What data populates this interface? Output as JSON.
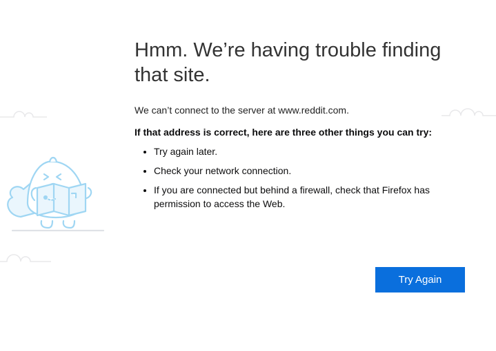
{
  "title": "Hmm. We’re having trouble finding that site.",
  "description": "We can’t connect to the server at www.reddit.com.",
  "instructions_heading": "If that address is correct, here are three other things you can try:",
  "suggestions": {
    "item1": "Try again later.",
    "item2": "Check your network connection.",
    "item3": "If you are connected but behind a firewall, check that Firefox has permission to access the Web."
  },
  "button_label": "Try Again"
}
